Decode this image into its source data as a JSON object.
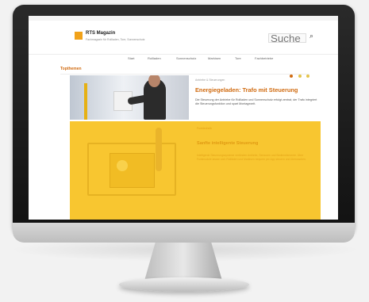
{
  "site": {
    "brand": "RTS Magazin",
    "tagline": "Fachmagazin für Rollladen, Tore, Sonnenschutz"
  },
  "search": {
    "placeholder": "Suche",
    "icon": "search-icon"
  },
  "nav": {
    "items": [
      "Start",
      "Rollladen",
      "Sonnenschutz",
      "Markisen",
      "Tore",
      "Fachbetriebe"
    ]
  },
  "section": {
    "title": "Topthemen"
  },
  "slider": {
    "dots": 3,
    "active_index": 0
  },
  "article": {
    "meta": "Antriebe & Steuerungen",
    "headline": "Energiegeladen: Trafo mit Steuerung",
    "description": "Die Steuerung der Antriebe für Rollladen und Sonnenschutz erfolgt zentral; der Trafo integriert die Steuerungsfunktion und spart Montagezeit."
  },
  "feature": {
    "label": "Funktechnik",
    "title": "Sanfte intelligente Steuerung",
    "text": "Intelligente Steuerungssysteme verbinden Antriebe, Sensoren und Bedienelemente. Über Funkmodule lassen sich Rollläden und Markisen bequem per App steuern und überwachen."
  },
  "colors": {
    "accent": "#d06a0f",
    "feature_bg": "#f8c630",
    "logo": "#f1a21a"
  }
}
